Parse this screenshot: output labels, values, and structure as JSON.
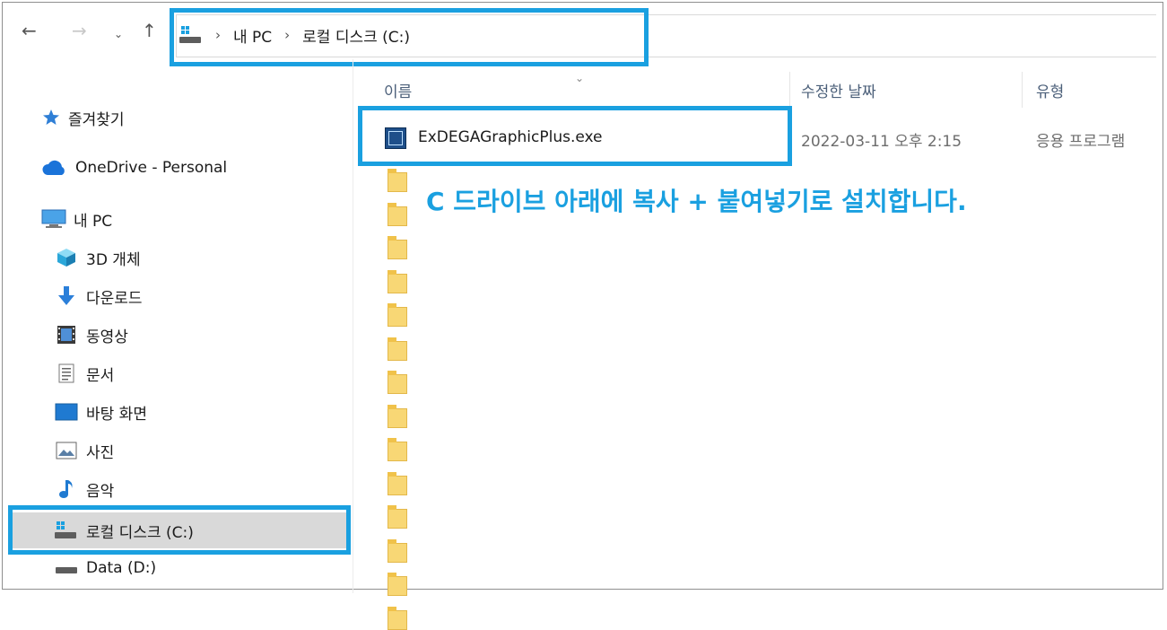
{
  "toolbar": {
    "back_icon": "arrow-left-icon",
    "forward_icon": "arrow-right-icon",
    "recent_icon": "chevron-down-icon",
    "up_icon": "arrow-up-icon",
    "breadcrumb": [
      "내 PC",
      "로컬 디스크 (C:)"
    ]
  },
  "sidebar": {
    "items": [
      {
        "label": "즐겨찾기",
        "icon": "star-icon"
      },
      {
        "label": "OneDrive - Personal",
        "icon": "cloud-icon"
      },
      {
        "label": "내 PC",
        "icon": "computer-icon"
      },
      {
        "label": "3D 개체",
        "icon": "cube-icon"
      },
      {
        "label": "다운로드",
        "icon": "download-icon"
      },
      {
        "label": "동영상",
        "icon": "video-icon"
      },
      {
        "label": "문서",
        "icon": "document-icon"
      },
      {
        "label": "바탕 화면",
        "icon": "desktop-icon"
      },
      {
        "label": "사진",
        "icon": "picture-icon"
      },
      {
        "label": "음악",
        "icon": "music-icon"
      },
      {
        "label": "로컬 디스크 (C:)",
        "icon": "drive-icon",
        "selected": true
      },
      {
        "label": "Data (D:)",
        "icon": "drive-icon"
      }
    ]
  },
  "columns": {
    "name": "이름",
    "date": "수정한 날짜",
    "type": "유형"
  },
  "files": [
    {
      "name": "ExDEGAGraphicPlus.exe",
      "date": "2022-03-11 오후 2:15",
      "type": "응용 프로그램"
    }
  ],
  "folder_rows": 14,
  "annotation": "C 드라이브 아래에 복사 + 붙여넣기로 설치합니다.",
  "colors": {
    "highlight": "#1aa0e0",
    "folder": "#f8d775",
    "selected_bg": "#d9d9d9"
  }
}
